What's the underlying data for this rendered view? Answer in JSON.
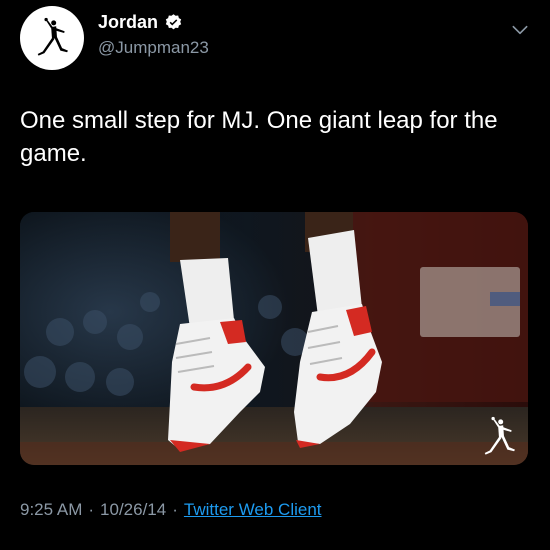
{
  "tweet": {
    "author": {
      "display_name": "Jordan",
      "handle": "@Jumpman23",
      "verified": true,
      "avatar_icon": "jumpman-logo-icon"
    },
    "menu_icon": "chevron-down-icon",
    "text": "One small step for MJ. One giant leap for the game.",
    "media": {
      "type": "photo",
      "description_icon": "jumpman-watermark-icon"
    },
    "meta": {
      "time": "9:25 AM",
      "separator": "·",
      "date": "10/26/14",
      "separator_2": "·",
      "source": "Twitter Web Client"
    }
  },
  "colors": {
    "background": "#000000",
    "text_primary": "#ffffff",
    "text_secondary": "#8b98a5",
    "link": "#1d9bf0",
    "verified_badge": "#ffffff"
  }
}
